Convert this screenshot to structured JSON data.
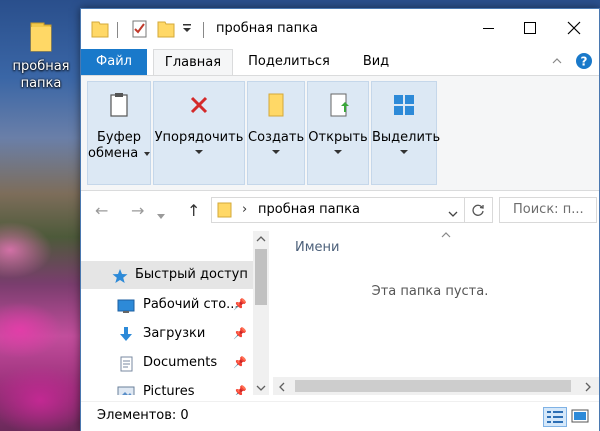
{
  "desktop": {
    "folder_label": "пробная папка"
  },
  "window": {
    "title": "пробная папка",
    "tabs": {
      "file": "Файл",
      "home": "Главная",
      "share": "Поделиться",
      "view": "Вид"
    },
    "ribbon": {
      "groups": [
        {
          "label_line1": "Буфер",
          "label_line2": "обмена",
          "icon": "clipboard-icon"
        },
        {
          "label_line1": "Упорядочить",
          "icon": "delete-x-icon"
        },
        {
          "label_line1": "Создать",
          "icon": "new-folder-icon"
        },
        {
          "label_line1": "Открыть",
          "icon": "open-properties-icon"
        },
        {
          "label_line1": "Выделить",
          "icon": "select-all-icon"
        }
      ]
    },
    "address": {
      "path": "пробная папка",
      "search_placeholder": "Поиск: п..."
    },
    "nav_pane": {
      "items": [
        {
          "label": "Быстрый доступ",
          "icon": "star-icon"
        },
        {
          "label": "Рабочий сто...",
          "icon": "desktop-icon"
        },
        {
          "label": "Загрузки",
          "icon": "download-arrow-icon"
        },
        {
          "label": "Documents",
          "icon": "document-icon"
        },
        {
          "label": "Pictures",
          "icon": "pictures-icon"
        }
      ]
    },
    "content": {
      "column_name": "Имени",
      "empty_message": "Эта папка пуста."
    },
    "status": {
      "items_text": "Элементов: 0"
    }
  },
  "colors": {
    "accent": "#1979ca",
    "ribbon_group": "#dce8f4",
    "folder": "#ffd866"
  }
}
